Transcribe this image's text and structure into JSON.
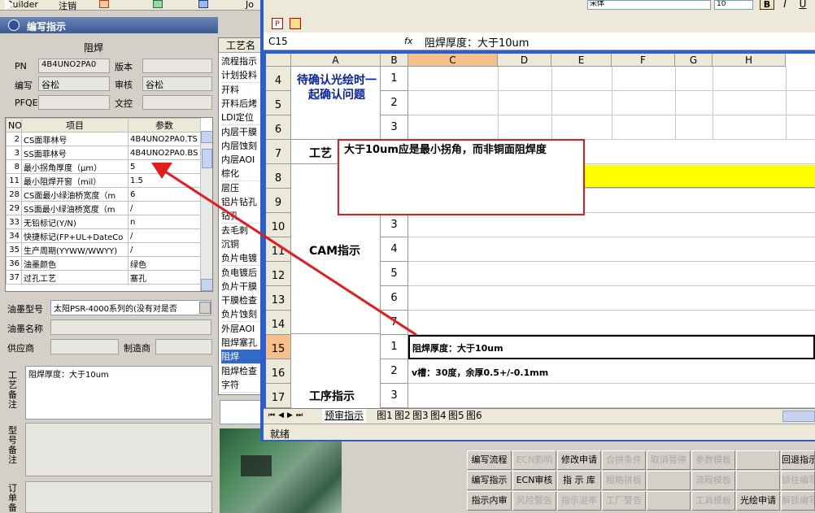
{
  "taskbar": {
    "items": [
      "Builder",
      "注销",
      "Jo"
    ]
  },
  "left_panel": {
    "title": "编写指示",
    "section": "阻焊",
    "pn_label": "PN",
    "pn_value": "4B4UNO2PA0",
    "version_label": "版本",
    "version_value": "",
    "writer_label": "编写",
    "writer_value": "谷松",
    "reviewer_label": "审核",
    "reviewer_value": "谷松",
    "pfqe_label": "PFQE",
    "pfqe_value": "",
    "control_label": "文控",
    "control_value": "",
    "table": {
      "headers": [
        "NO",
        "项目",
        "参数"
      ],
      "rows": [
        {
          "no": "2",
          "item": "CS面菲林号",
          "param": "4B4UNO2PA0.TS"
        },
        {
          "no": "3",
          "item": "SS面菲林号",
          "param": "4B4UNO2PA0.BS"
        },
        {
          "no": "8",
          "item": "最小拐角厚度（μm）",
          "param": "5"
        },
        {
          "no": "11",
          "item": "最小阻焊开窗（mil）",
          "param": "1.5"
        },
        {
          "no": "28",
          "item": "CS面最小绿油桥宽度（m",
          "param": "6"
        },
        {
          "no": "29",
          "item": "SS面最小绿油桥宽度（m",
          "param": "/"
        },
        {
          "no": "33",
          "item": "无铅标记(Y/N)",
          "param": "n"
        },
        {
          "no": "34",
          "item": "快捷标记(FP+UL+DateCo",
          "param": "/"
        },
        {
          "no": "35",
          "item": "生产周期(YYWW/WWYY)",
          "param": "/"
        },
        {
          "no": "36",
          "item": "油墨颜色",
          "param": "绿色"
        },
        {
          "no": "37",
          "item": "过孔工艺",
          "param": "塞孔"
        }
      ]
    },
    "ink_type_label": "油墨型号",
    "ink_type_value": "太阳PSR-4000系列的(没有对是否",
    "ink_name_label": "油墨名称",
    "supplier_label": "供应商",
    "maker_label": "制造商",
    "process_note_label": "工艺备注",
    "process_note_value": "阻焊厚度：大于10um",
    "type_note_label": "型号备注",
    "order_note_label": "订单备"
  },
  "process_list": {
    "header": "工艺名",
    "items": [
      "流程指示",
      "计划投料",
      "开料",
      "开料后烤",
      "LDI定位",
      "内层干膜",
      "内层蚀刻",
      "内层AOI",
      "棕化",
      "层压",
      "铝片钻孔",
      "钻孔",
      "去毛刺",
      "沉铜",
      "负片电镀",
      "负电镀后",
      "负片干膜",
      "干膜检查",
      "负片蚀刻",
      "外层AOI",
      "阻焊塞孔",
      "阻焊",
      "阻焊检查",
      "字符"
    ],
    "selected": "阻焊"
  },
  "excel": {
    "toolbar_font": "宋体",
    "toolbar_size": "10",
    "name_box": "C15",
    "fx": "fx",
    "formula": "阻焊厚度：大于10um",
    "columns": [
      "A",
      "B",
      "C",
      "D",
      "E",
      "F",
      "G",
      "H"
    ],
    "rows": [
      "4",
      "5",
      "6",
      "7",
      "8",
      "9",
      "10",
      "11",
      "12",
      "13",
      "14",
      "15",
      "16",
      "17"
    ],
    "cells": {
      "a_confirm": "待确认光绘时一起确认问题",
      "a_process": "工艺",
      "a_cam": "CAM指示",
      "a_step": "工序指示",
      "b_values": [
        "1",
        "2",
        "3",
        "",
        "",
        "",
        "3",
        "4",
        "5",
        "6",
        "7",
        "1",
        "2",
        "3"
      ],
      "c15": "阻焊厚度：大于10um",
      "c16": "v槽：30度，余厚0.5+/-0.1mm"
    },
    "comment": "大于10um应是最小拐角，而非铜面阻焊度",
    "sheet_tabs": [
      "预审指示",
      "图1",
      "图2",
      "图3",
      "图4",
      "图5",
      "图6"
    ],
    "active_tab": "预审指示",
    "status": "就绪",
    "colors": {
      "selected_row_fill": "#ffff00",
      "header_blue": "#0a24a0",
      "annotation_red": "#e31b1b"
    }
  },
  "bottom_buttons": {
    "rows": [
      [
        "编写流程",
        "ECN影响",
        "修改申请",
        "合拼条件",
        "取消暂停",
        "参数模板",
        "",
        "回退指示"
      ],
      [
        "编写指示",
        "ECN审核",
        "指 示 库",
        "粗略拼板",
        "",
        "流程模板",
        "",
        "锁住编写"
      ],
      [
        "指示内审",
        "风险警告",
        "指示退率",
        "工厂警告",
        "",
        "工具模板",
        "光绘申请",
        "解锁编写"
      ]
    ],
    "disabled": [
      "ECN影响",
      "合拼条件",
      "取消暂停",
      "参数模板",
      "粗略拼板",
      "流程模板",
      "风险警告",
      "指示退率",
      "工厂警告",
      "工具模板",
      "锁住编写",
      "解锁编写"
    ]
  }
}
